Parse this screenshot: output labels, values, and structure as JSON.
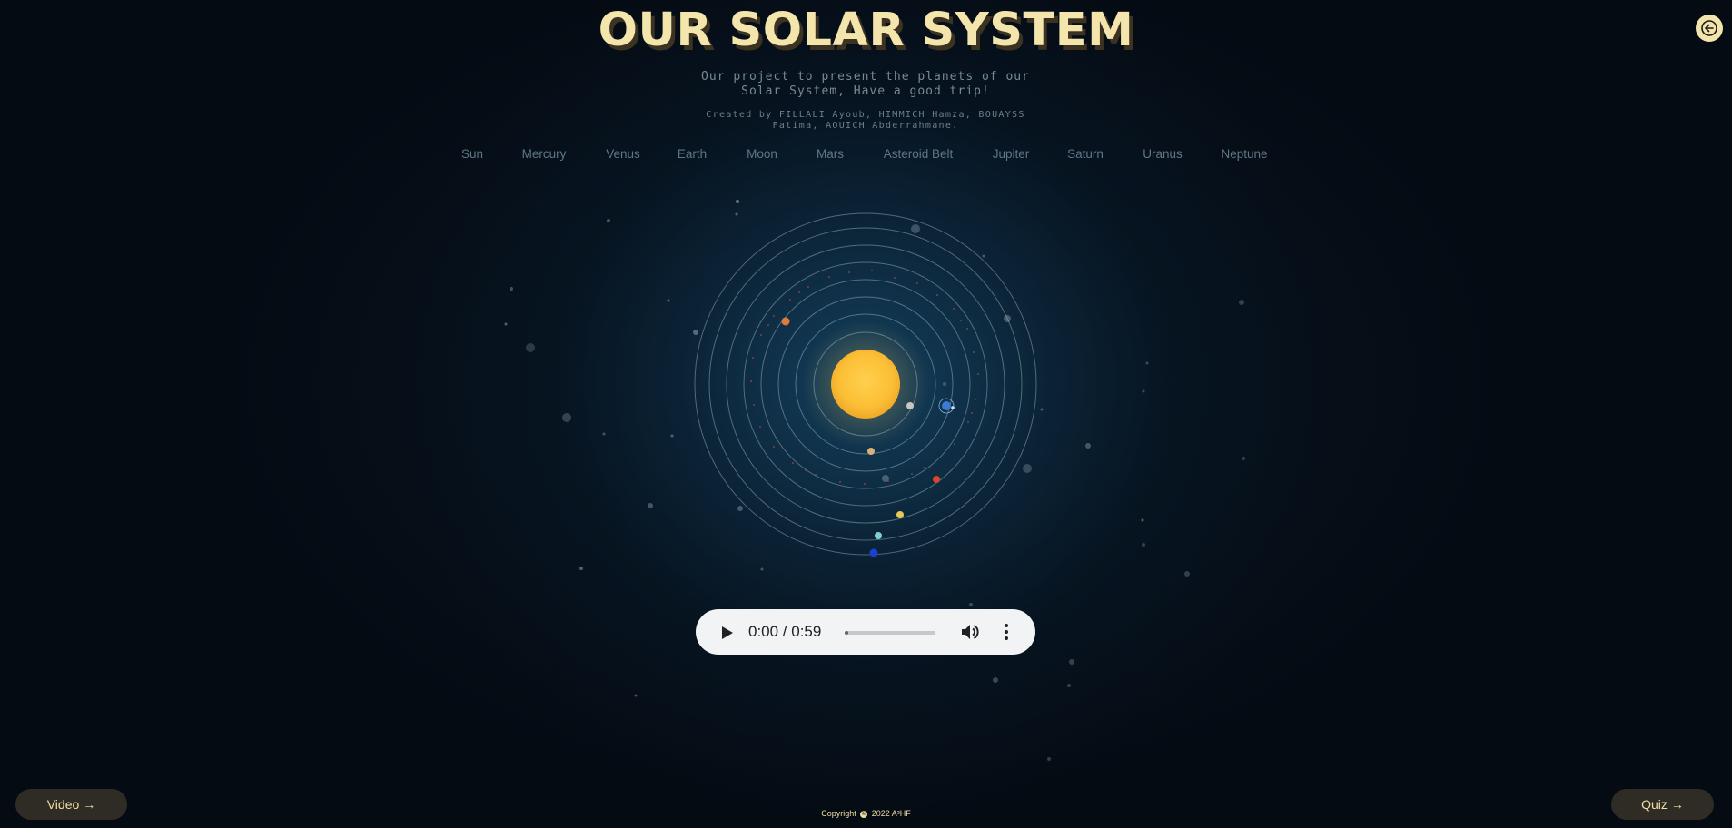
{
  "page": {
    "title": "OUR SOLAR SYSTEM",
    "subtitle": "Our project to present the planets of our Solar System, Have a good trip!",
    "credits": "Created by FILLALI Ayoub, HIMMICH Hamza, BOUAYSS Fatima, AOUICH Abderrahmane."
  },
  "nav": {
    "items": [
      {
        "label": "Sun"
      },
      {
        "label": "Mercury"
      },
      {
        "label": "Venus"
      },
      {
        "label": "Earth"
      },
      {
        "label": "Moon"
      },
      {
        "label": "Mars"
      },
      {
        "label": "Asteroid Belt"
      },
      {
        "label": "Jupiter"
      },
      {
        "label": "Saturn"
      },
      {
        "label": "Uranus"
      },
      {
        "label": "Neptune"
      }
    ]
  },
  "header": {
    "back_icon": "arrow-left-icon"
  },
  "audio": {
    "time_label": "0:00 / 0:59",
    "progress": 0.0,
    "play_icon": "play-icon",
    "volume_icon": "volume-icon",
    "menu_icon": "more-vertical-icon"
  },
  "footer": {
    "video_label": "Video",
    "quiz_label": "Quiz",
    "copyright_prefix": "Copyright",
    "copyright_suffix": "2022 A²HF"
  },
  "colors": {
    "accent": "#f3e5ab",
    "background": "#050b13",
    "sun": "#fbbf35",
    "button_bg": "#2f2c25"
  }
}
